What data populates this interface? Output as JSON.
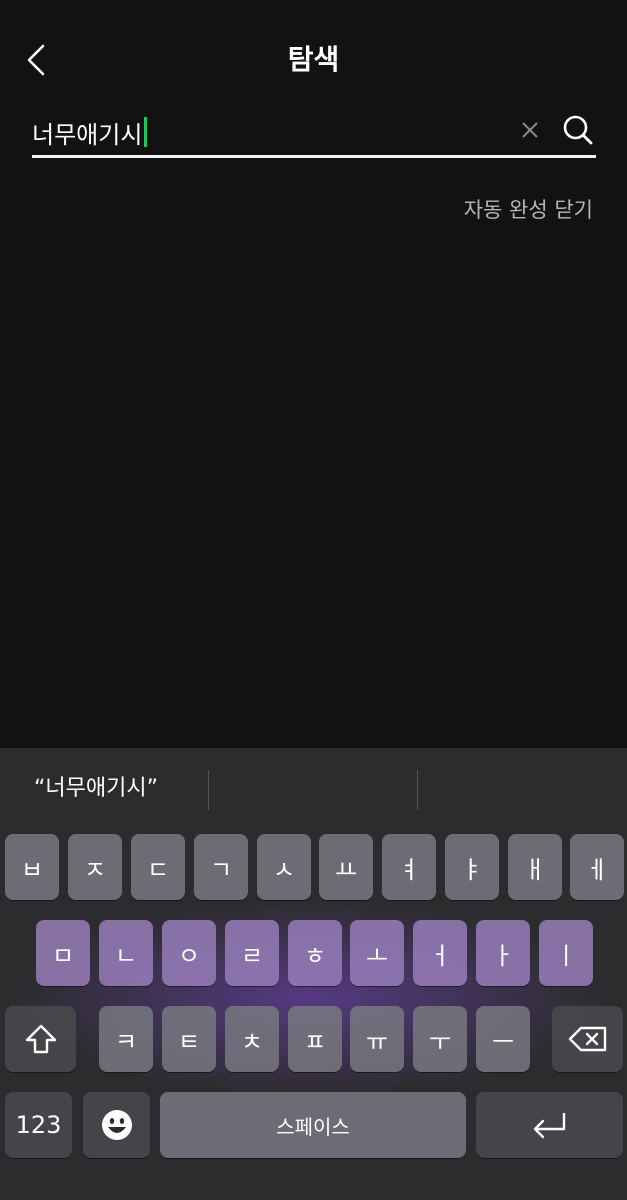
{
  "header": {
    "title": "탐색"
  },
  "search": {
    "value": "너무애기시",
    "autocomplete_close": "자동 완성 닫기"
  },
  "keyboard": {
    "suggestions": [
      "“너무애기시”",
      "",
      ""
    ],
    "row1": [
      "ㅂ",
      "ㅈ",
      "ㄷ",
      "ㄱ",
      "ㅅ",
      "ㅛ",
      "ㅕ",
      "ㅑ",
      "ㅐ",
      "ㅔ"
    ],
    "row2": [
      "ㅁ",
      "ㄴ",
      "ㅇ",
      "ㄹ",
      "ㅎ",
      "ㅗ",
      "ㅓ",
      "ㅏ",
      "ㅣ"
    ],
    "row3": [
      "ㅋ",
      "ㅌ",
      "ㅊ",
      "ㅍ",
      "ㅠ",
      "ㅜ",
      "ㅡ"
    ],
    "numbers_label": "123",
    "space_label": "스페이스",
    "icons": {
      "shift": "shift-icon",
      "backspace": "backspace-icon",
      "emoji": "emoji-icon",
      "return": "return-icon"
    }
  },
  "colors": {
    "background": "#121212",
    "caret": "#22c55e",
    "keyboard_glow": "#7846c8"
  }
}
